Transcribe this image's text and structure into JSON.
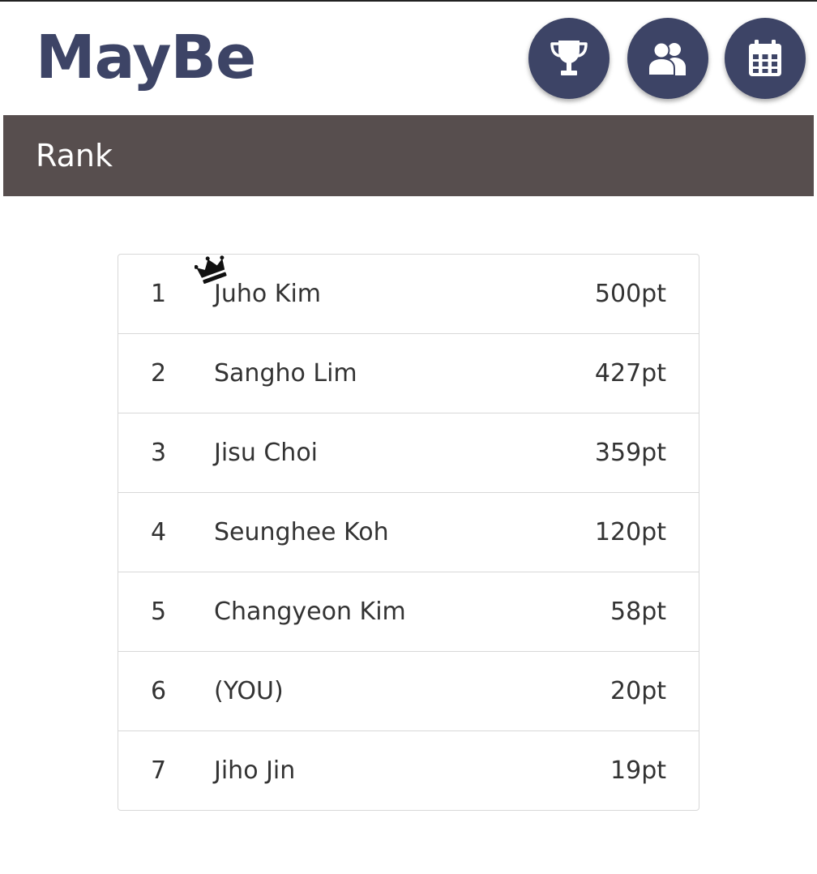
{
  "app": {
    "name": "MayBe",
    "accent_color": "#3d4466",
    "title_bar_color": "#574e4e"
  },
  "nav": {
    "buttons": [
      {
        "icon": "trophy-icon"
      },
      {
        "icon": "people-icon"
      },
      {
        "icon": "calendar-icon"
      }
    ]
  },
  "page": {
    "title": "Rank"
  },
  "ranking": {
    "leader_badge": "crown-icon",
    "rows": [
      {
        "rank": "1",
        "name": "Juho Kim",
        "points": "500pt"
      },
      {
        "rank": "2",
        "name": "Sangho Lim",
        "points": "427pt"
      },
      {
        "rank": "3",
        "name": "Jisu Choi",
        "points": "359pt"
      },
      {
        "rank": "4",
        "name": "Seunghee Koh",
        "points": "120pt"
      },
      {
        "rank": "5",
        "name": "Changyeon Kim",
        "points": "58pt"
      },
      {
        "rank": "6",
        "name": "(YOU)",
        "points": "20pt"
      },
      {
        "rank": "7",
        "name": "Jiho Jin",
        "points": "19pt"
      }
    ]
  }
}
